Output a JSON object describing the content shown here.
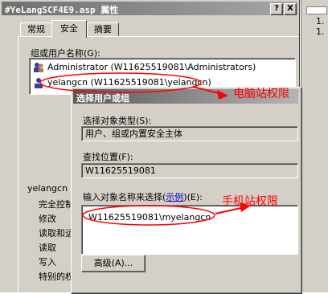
{
  "main_window": {
    "title": "#YeLangSCF4E9.asp 属性",
    "help_button": "?",
    "close_button": "X",
    "tabs": [
      {
        "label": "常规"
      },
      {
        "label": "安全"
      },
      {
        "label": "摘要"
      }
    ],
    "users_label": "组或用户名称(G):",
    "users": [
      {
        "label": "Administrator (W11625519081\\Administrators)"
      },
      {
        "label": "yelangcn (W11625519081\\yelangcn)"
      }
    ],
    "perm_user_label": "yelangcn",
    "permissions": [
      {
        "label": "完全控制"
      },
      {
        "label": "修改"
      },
      {
        "label": "读取和运行"
      },
      {
        "label": "读取"
      },
      {
        "label": "写入"
      },
      {
        "label": "特别的权限"
      }
    ]
  },
  "right_window": {
    "lines": [
      "1.",
      "1."
    ]
  },
  "dialog": {
    "title": "选择用户或组",
    "object_type_label": "选择对象类型(S):",
    "object_type_value": "用户、组或内置安全主体",
    "location_label": "查找位置(F):",
    "location_value": "W11625519081",
    "input_label_prefix": "输入对象名称来选择(",
    "input_label_link": "示例",
    "input_label_suffix": ")(E):",
    "input_value": "W11625519081\\myelangcn",
    "advanced_button": "高级(A)..."
  },
  "annotations": {
    "pc_text": "电脑站权限",
    "phone_text": "手机站权限",
    "color": "#ff0000"
  }
}
